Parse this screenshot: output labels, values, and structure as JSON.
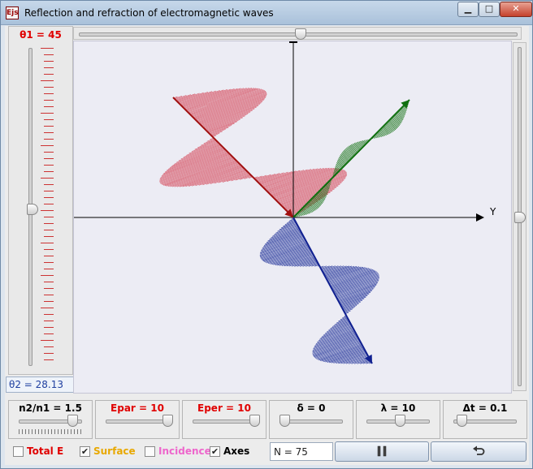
{
  "window": {
    "app_icon": "Ejs",
    "title": "Reflection and refraction of electromagnetic waves",
    "minimize": "▁",
    "maximize": "□",
    "close": "✕"
  },
  "theta1_label": "θ1 = 45",
  "theta2_label": "θ2 = 28.13",
  "axis_y_label": "Y",
  "sliders": [
    {
      "label": "n2/n1 = 1.5",
      "color": "#000000",
      "position": 0.85
    },
    {
      "label": "Epar = 10",
      "color": "#e00000",
      "position": 1.0
    },
    {
      "label": "Eper = 10",
      "color": "#e00000",
      "position": 1.0
    },
    {
      "label": "δ = 0",
      "color": "#000000",
      "position": 0.0
    },
    {
      "label": "λ = 10",
      "color": "#000000",
      "position": 0.5
    },
    {
      "label": "Δt = 0.1",
      "color": "#000000",
      "position": 0.05
    }
  ],
  "theta1_slider_position": 0.5,
  "top_slider_position": 0.5,
  "right_slider_position": 0.5,
  "checkboxes": [
    {
      "label": "Total E",
      "color": "#e00000",
      "checked": false
    },
    {
      "label": "Surface",
      "color": "#e8a800",
      "checked": true
    },
    {
      "label": "Incidence",
      "color": "#ee66cc",
      "checked": false
    },
    {
      "label": "Axes",
      "color": "#000000",
      "checked": true
    }
  ],
  "n_field": "N = 75",
  "pause_icon": "pause-icon",
  "reset_icon": "undo-icon",
  "colors": {
    "incident": "#a01010",
    "incident_wave": "#d86070",
    "reflected": "#107010",
    "refracted": "#102090",
    "refracted_wave": "#3040a0"
  }
}
